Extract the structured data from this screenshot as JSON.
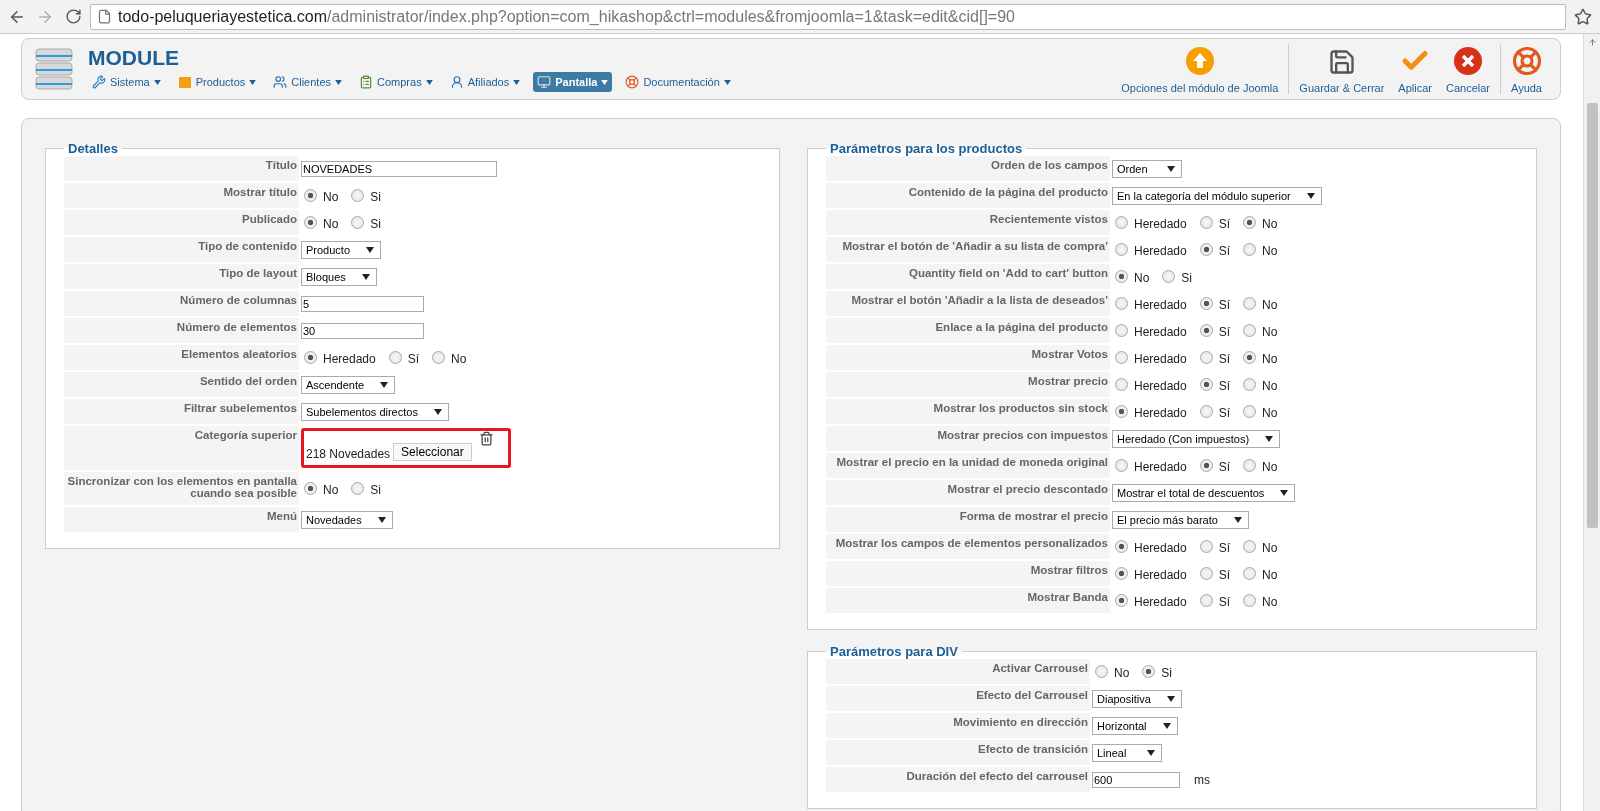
{
  "browser": {
    "url_host": "todo-peluqueriayestetica.com",
    "url_path": "/administrator/index.php?option=com_hikashop&ctrl=modules&fromjoomla=1&task=edit&cid[]=90"
  },
  "toolbar": {
    "title": "MODULE",
    "menu": [
      {
        "label": "Sistema",
        "selected": false
      },
      {
        "label": "Productos",
        "selected": false
      },
      {
        "label": "Clientes",
        "selected": false
      },
      {
        "label": "Compras",
        "selected": false
      },
      {
        "label": "Afiliados",
        "selected": false
      },
      {
        "label": "Pantalla",
        "selected": true
      },
      {
        "label": "Documentación",
        "selected": false
      }
    ],
    "button_groups": [
      [
        {
          "kind": "options",
          "label": "Opciones del módulo de Joomla"
        }
      ],
      [
        {
          "kind": "save",
          "label": "Guardar & Cerrar"
        },
        {
          "kind": "apply",
          "label": "Aplicar"
        },
        {
          "kind": "cancel",
          "label": "Cancelar"
        }
      ],
      [
        {
          "kind": "help",
          "label": "Ayuda"
        }
      ]
    ]
  },
  "panels": [
    {
      "legend": "Detalles",
      "rows": [
        {
          "label": "Título",
          "kind": "input",
          "value": "NOVEDADES"
        },
        {
          "label": "Mostrar título",
          "kind": "radio",
          "options": [
            {
              "label": "No",
              "selected": true
            },
            {
              "label": "Si",
              "selected": false
            }
          ]
        },
        {
          "label": "Publicado",
          "kind": "radio",
          "options": [
            {
              "label": "No",
              "selected": true
            },
            {
              "label": "Si",
              "selected": false
            }
          ]
        },
        {
          "label": "Tipo de contenido",
          "kind": "select",
          "value": "Producto"
        },
        {
          "label": "Tipo de layout",
          "kind": "select",
          "value": "Bloques"
        },
        {
          "label": "Número de columnas",
          "kind": "input",
          "value": "5"
        },
        {
          "label": "Número de elementos",
          "kind": "input",
          "value": "30"
        },
        {
          "label": "Elementos aleatorios",
          "kind": "radio",
          "options": [
            {
              "label": "Heredado",
              "selected": true
            },
            {
              "label": "Sí",
              "selected": false
            },
            {
              "label": "No",
              "selected": false
            }
          ]
        },
        {
          "label": "Sentido del orden",
          "kind": "select",
          "value": "Ascendente"
        },
        {
          "label": "Filtrar subelementos",
          "kind": "select",
          "value": "Subelementos directos"
        },
        {
          "label": "Categoría superior",
          "kind": "category",
          "value": "218 Novedades",
          "button": "Seleccionar",
          "highlighted": true
        },
        {
          "label": "Sincronizar con los elementos en pantalla cuando sea posible",
          "kind": "radio",
          "options": [
            {
              "label": "No",
              "selected": true
            },
            {
              "label": "Si",
              "selected": false
            }
          ]
        },
        {
          "label": "Menú",
          "kind": "select",
          "value": "Novedades"
        }
      ]
    },
    {
      "legend": "Parámetros para los productos",
      "rows": [
        {
          "label": "Orden de los campos",
          "kind": "select",
          "value": "Orden"
        },
        {
          "label": "Contenido de la página del producto",
          "kind": "select",
          "value": "En la categoría del módulo superior"
        },
        {
          "label": "Recientemente vistos",
          "kind": "radio",
          "options": [
            {
              "label": "Heredado",
              "selected": false
            },
            {
              "label": "Sí",
              "selected": false
            },
            {
              "label": "No",
              "selected": true
            }
          ]
        },
        {
          "label": "Mostrar el botón de 'Añadir a su lista de compra'",
          "kind": "radio",
          "options": [
            {
              "label": "Heredado",
              "selected": false
            },
            {
              "label": "Sí",
              "selected": true
            },
            {
              "label": "No",
              "selected": false
            }
          ]
        },
        {
          "label": "Quantity field on 'Add to cart' button",
          "kind": "radio",
          "options": [
            {
              "label": "No",
              "selected": true
            },
            {
              "label": "Si",
              "selected": false
            }
          ]
        },
        {
          "label": "Mostrar el botón 'Añadir a la lista de deseados'",
          "kind": "radio",
          "options": [
            {
              "label": "Heredado",
              "selected": false
            },
            {
              "label": "Sí",
              "selected": true
            },
            {
              "label": "No",
              "selected": false
            }
          ]
        },
        {
          "label": "Enlace a la página del producto",
          "kind": "radio",
          "options": [
            {
              "label": "Heredado",
              "selected": false
            },
            {
              "label": "Sí",
              "selected": true
            },
            {
              "label": "No",
              "selected": false
            }
          ]
        },
        {
          "label": "Mostrar Votos",
          "kind": "radio",
          "options": [
            {
              "label": "Heredado",
              "selected": false
            },
            {
              "label": "Sí",
              "selected": false
            },
            {
              "label": "No",
              "selected": true
            }
          ]
        },
        {
          "label": "Mostrar precio",
          "kind": "radio",
          "options": [
            {
              "label": "Heredado",
              "selected": false
            },
            {
              "label": "Sí",
              "selected": true
            },
            {
              "label": "No",
              "selected": false
            }
          ]
        },
        {
          "label": "Mostrar los productos sin stock",
          "kind": "radio",
          "options": [
            {
              "label": "Heredado",
              "selected": true
            },
            {
              "label": "Sí",
              "selected": false
            },
            {
              "label": "No",
              "selected": false
            }
          ]
        },
        {
          "label": "Mostrar precios con impuestos",
          "kind": "select",
          "value": "Heredado (Con impuestos)"
        },
        {
          "label": "Mostrar el precio en la unidad de moneda original",
          "kind": "radio",
          "options": [
            {
              "label": "Heredado",
              "selected": false
            },
            {
              "label": "Sí",
              "selected": true
            },
            {
              "label": "No",
              "selected": false
            }
          ]
        },
        {
          "label": "Mostrar el precio descontado",
          "kind": "select",
          "value": "Mostrar el total de descuentos"
        },
        {
          "label": "Forma de mostrar el precio",
          "kind": "select",
          "value": "El precio más barato"
        },
        {
          "label": "Mostrar los campos de elementos personalizados",
          "kind": "radio",
          "options": [
            {
              "label": "Heredado",
              "selected": true
            },
            {
              "label": "Sí",
              "selected": false
            },
            {
              "label": "No",
              "selected": false
            }
          ]
        },
        {
          "label": "Mostrar filtros",
          "kind": "radio",
          "options": [
            {
              "label": "Heredado",
              "selected": true
            },
            {
              "label": "Sí",
              "selected": false
            },
            {
              "label": "No",
              "selected": false
            }
          ]
        },
        {
          "label": "Mostrar Banda",
          "kind": "radio",
          "options": [
            {
              "label": "Heredado",
              "selected": true
            },
            {
              "label": "Sí",
              "selected": false
            },
            {
              "label": "No",
              "selected": false
            }
          ]
        }
      ]
    },
    {
      "legend": "Parámetros para DIV",
      "rows": [
        {
          "label": "Activar Carrousel",
          "kind": "radio",
          "options": [
            {
              "label": "No",
              "selected": false
            },
            {
              "label": "Si",
              "selected": true
            }
          ]
        },
        {
          "label": "Efecto del Carrousel",
          "kind": "select",
          "value": "Diapositiva"
        },
        {
          "label": "Movimiento en dirección",
          "kind": "select",
          "value": "Horizontal"
        },
        {
          "label": "Efecto de transición",
          "kind": "select",
          "value": "Lineal"
        },
        {
          "label": "Duración del efecto del carrousel",
          "kind": "input",
          "value": "600",
          "unit": "ms"
        }
      ]
    }
  ]
}
